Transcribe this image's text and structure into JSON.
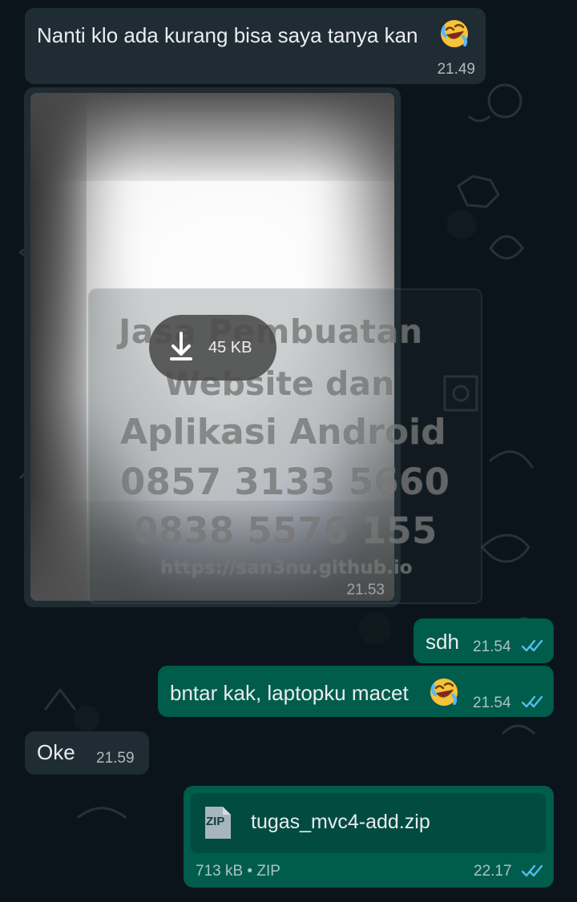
{
  "chat": {
    "message_1": {
      "text": "Nanti klo ada kurang bisa  saya tanya kan",
      "time": "21.49",
      "emoji": "rolling-on-the-floor-laughing-icon"
    },
    "image_message": {
      "download_size": "45 KB",
      "time": "21.53",
      "watermark_lines": [
        "Jasa Pembuatan",
        "Website dan",
        "Aplikasi Android",
        "0857 3133 5660",
        "0838 5576 155",
        "https://san3nu.github.io"
      ]
    },
    "message_2": {
      "text": "sdh",
      "time": "21.54"
    },
    "message_3": {
      "text": "bntar kak, laptopku macet",
      "time": "21.54",
      "emoji": "rolling-on-the-floor-laughing-icon"
    },
    "message_4": {
      "text": "Oke",
      "time": "21.59"
    },
    "file_message": {
      "icon_label": "ZIP",
      "file_name": "tugas_mvc4-add.zip",
      "meta": "713 kB • ZIP",
      "time": "22.17"
    }
  },
  "colors": {
    "background": "#0b141a",
    "incoming_bubble": "#202c33",
    "outgoing_bubble": "#005c4b",
    "read_ticks": "#53bdeb"
  }
}
